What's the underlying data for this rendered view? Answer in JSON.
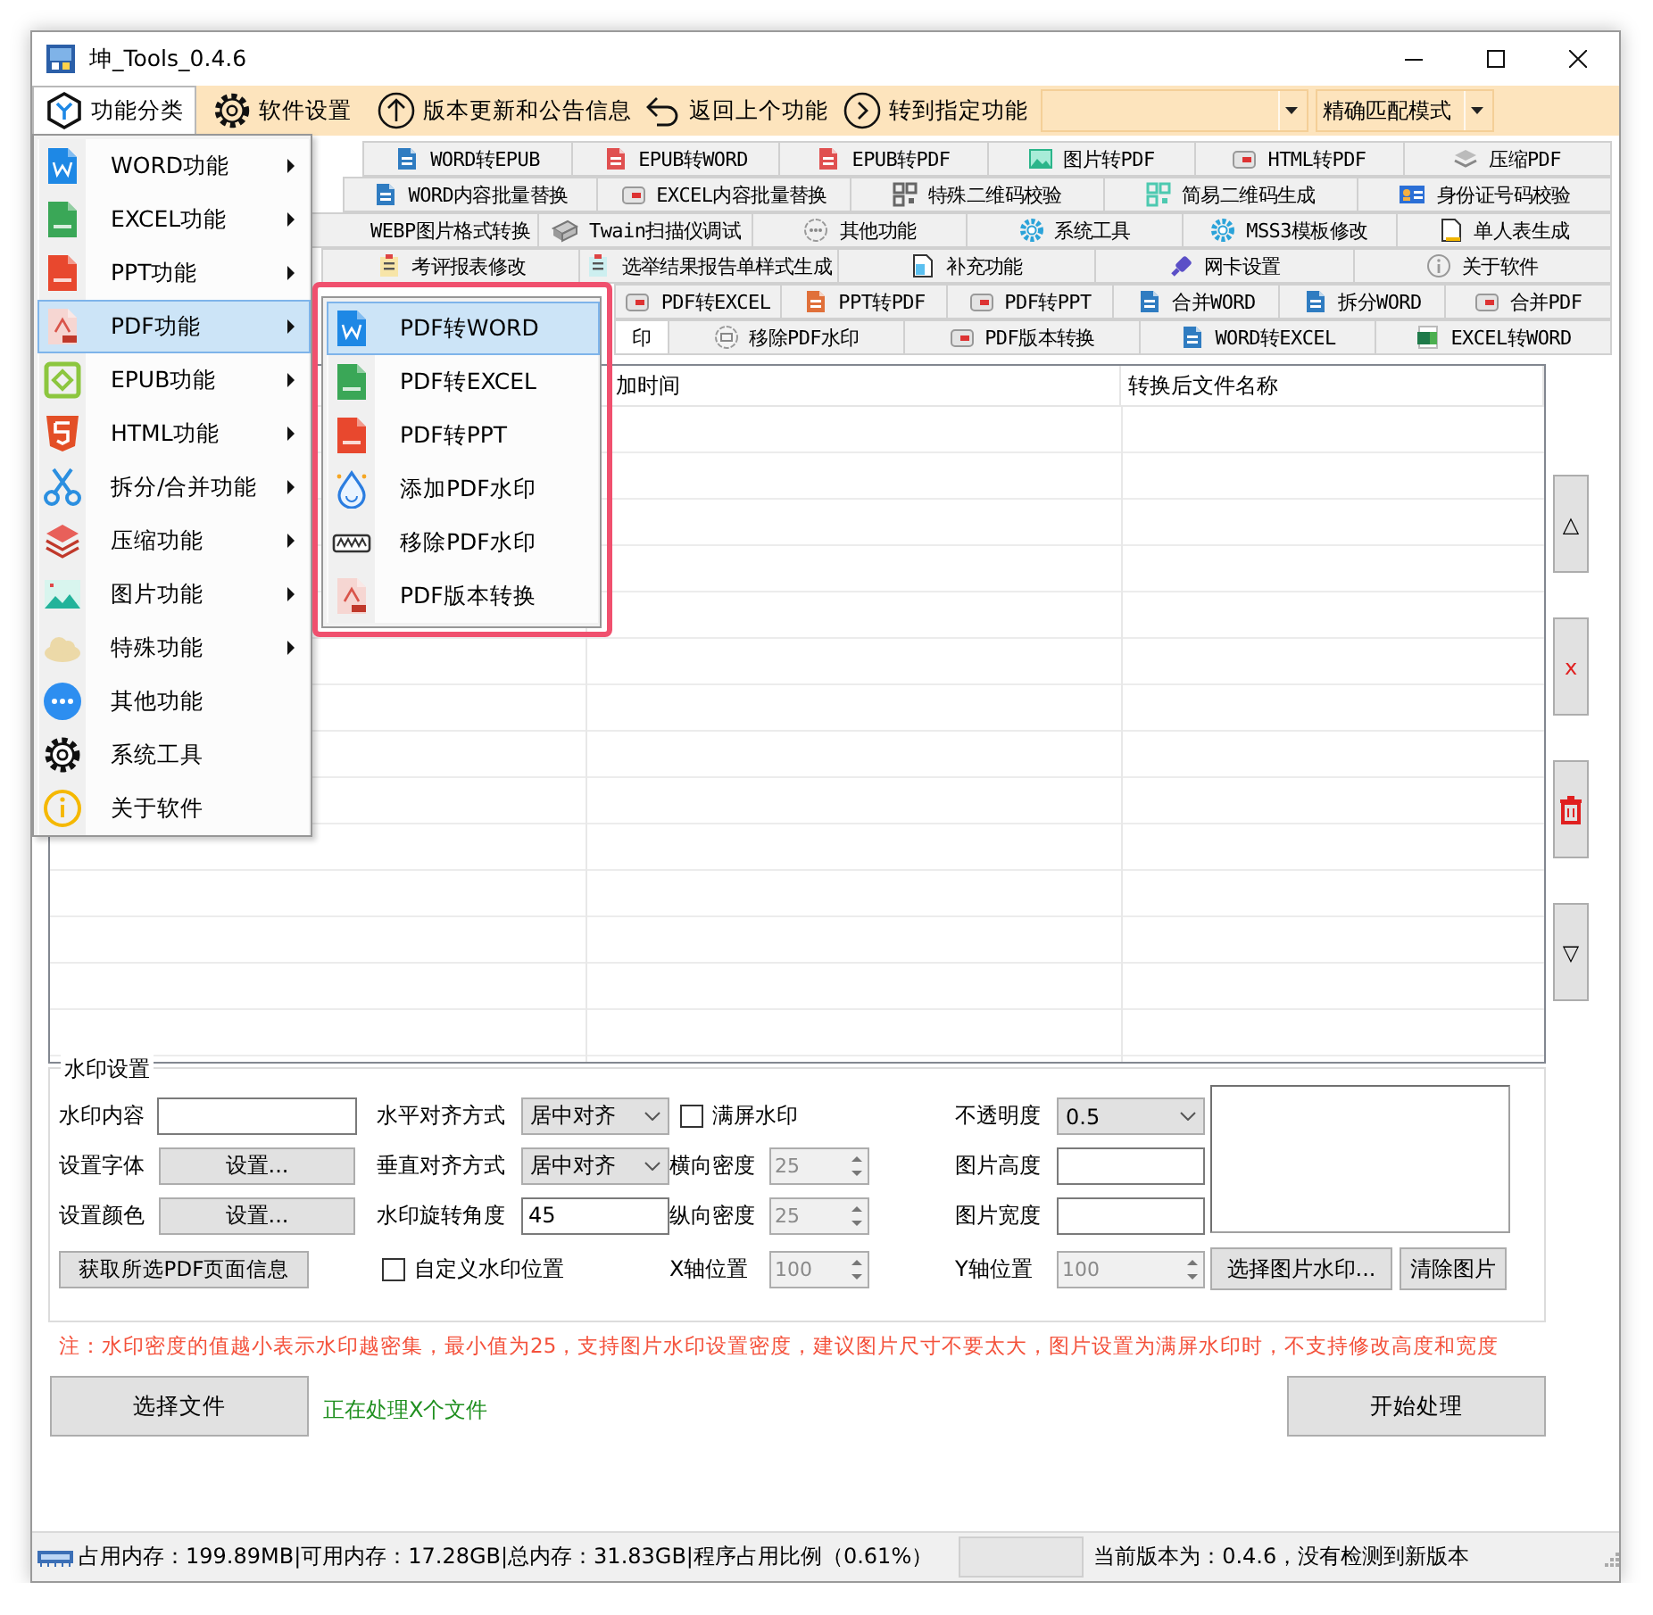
{
  "window": {
    "title": "坤_Tools_0.4.6"
  },
  "toolbar": {
    "items": [
      {
        "label": "功能分类",
        "selected": true
      },
      {
        "label": "软件设置",
        "selected": false
      },
      {
        "label": "版本更新和公告信息",
        "selected": false
      },
      {
        "label": "返回上个功能",
        "selected": false
      },
      {
        "label": "转到指定功能",
        "selected": false
      }
    ],
    "match_mode": "精确匹配模式"
  },
  "tab_rows": [
    [
      {
        "label": "WORD转EPUB",
        "selected": false
      },
      {
        "label": "EPUB转WORD",
        "selected": false
      },
      {
        "label": "EPUB转PDF",
        "selected": false
      },
      {
        "label": "图片转PDF",
        "selected": false
      },
      {
        "label": "HTML转PDF",
        "selected": false
      },
      {
        "label": "压缩PDF",
        "selected": false
      }
    ],
    [
      {
        "label": "WORD内容批量替换",
        "selected": false
      },
      {
        "label": "EXCEL内容批量替换",
        "selected": false
      },
      {
        "label": "特殊二维码校验",
        "selected": false
      },
      {
        "label": "简易二维码生成",
        "selected": false
      },
      {
        "label": "身份证号码校验",
        "selected": false
      }
    ],
    [
      {
        "label": "WEBP图片格式转换",
        "selected": false
      },
      {
        "label": "Twain扫描仪调试",
        "selected": false
      },
      {
        "label": "其他功能",
        "selected": false
      },
      {
        "label": "系统工具",
        "selected": false
      },
      {
        "label": "MSS3模板修改",
        "selected": false
      },
      {
        "label": "单人表生成",
        "selected": false
      }
    ],
    [
      {
        "label": "考评报表修改",
        "selected": false
      },
      {
        "label": "选举结果报告单样式生成",
        "selected": false
      },
      {
        "label": "补充功能",
        "selected": false
      },
      {
        "label": "网卡设置",
        "selected": false
      },
      {
        "label": "关于软件",
        "selected": false
      }
    ],
    [
      {
        "label": "PDF转EXCEL",
        "selected": false
      },
      {
        "label": "PPT转PDF",
        "selected": false
      },
      {
        "label": "PDF转PPT",
        "selected": false
      },
      {
        "label": "合并WORD",
        "selected": false
      },
      {
        "label": "拆分WORD",
        "selected": false
      },
      {
        "label": "合并PDF",
        "selected": false
      }
    ],
    [
      {
        "label": "印",
        "selected": true
      },
      {
        "label": "移除PDF水印",
        "selected": false
      },
      {
        "label": "PDF版本转换",
        "selected": false
      },
      {
        "label": "WORD转EXCEL",
        "selected": false
      },
      {
        "label": "EXCEL转WORD",
        "selected": false
      }
    ]
  ],
  "table": {
    "headers": [
      "加时间",
      "转换后文件名称"
    ]
  },
  "side_buttons": [
    {
      "kind": "glyph",
      "label": "△"
    },
    {
      "kind": "danger_glyph",
      "label": "x"
    },
    {
      "kind": "trash"
    },
    {
      "kind": "glyph",
      "label": "▽"
    }
  ],
  "watermark_settings": {
    "title": "水印设置",
    "content": {
      "label": "水印内容"
    },
    "font": {
      "label": "设置字体",
      "button": "设置..."
    },
    "color": {
      "label": "设置颜色",
      "button": "设置..."
    },
    "page_info_button": "获取所选PDF页面信息",
    "h_align": {
      "label": "水平对齐方式",
      "value": "居中对齐"
    },
    "v_align": {
      "label": "垂直对齐方式",
      "value": "居中对齐"
    },
    "rotation": {
      "label": "水印旋转角度",
      "value": "45"
    },
    "custom_position": {
      "label": "自定义水印位置",
      "checked": false
    },
    "fullscreen": {
      "label": "满屏水印",
      "checked": false
    },
    "h_density": {
      "label": "横向密度",
      "value": "25",
      "disabled": true
    },
    "v_density": {
      "label": "纵向密度",
      "value": "25",
      "disabled": true
    },
    "x_pos": {
      "label": "X轴位置",
      "value": "100",
      "disabled": true
    },
    "opacity": {
      "label": "不透明度",
      "value": "0.5"
    },
    "image_height": {
      "label": "图片高度"
    },
    "image_width": {
      "label": "图片宽度"
    },
    "y_pos": {
      "label": "Y轴位置",
      "value": "100",
      "disabled": true
    },
    "choose_image_button": "选择图片水印...",
    "clear_image_button": "清除图片"
  },
  "note": "注：水印密度的值越小表示水印越密集，最小值为25，支持图片水印设置密度，建议图片尺寸不要太大，图片设置为满屏水印时，不支持修改高度和宽度",
  "choose_file_button": "选择文件",
  "progress_text": "正在处理X个文件",
  "start_button": "开始处理",
  "status_bar": {
    "memory": "占用内存：199.89MB|可用内存：17.28GB|总内存：31.83GB|程序占用比例（0.61%）",
    "version": "当前版本为：0.4.6，没有检测到新版本"
  },
  "menu": {
    "items": [
      {
        "label": "WORD功能",
        "has_submenu": true,
        "selected": false
      },
      {
        "label": "EXCEL功能",
        "has_submenu": true,
        "selected": false
      },
      {
        "label": "PPT功能",
        "has_submenu": true,
        "selected": false
      },
      {
        "label": "PDF功能",
        "has_submenu": true,
        "selected": true
      },
      {
        "label": "EPUB功能",
        "has_submenu": true,
        "selected": false
      },
      {
        "label": "HTML功能",
        "has_submenu": true,
        "selected": false
      },
      {
        "label": "拆分/合并功能",
        "has_submenu": true,
        "selected": false
      },
      {
        "label": "压缩功能",
        "has_submenu": true,
        "selected": false
      },
      {
        "label": "图片功能",
        "has_submenu": true,
        "selected": false
      },
      {
        "label": "特殊功能",
        "has_submenu": true,
        "selected": false
      },
      {
        "label": "其他功能",
        "has_submenu": false,
        "selected": false
      },
      {
        "label": "系统工具",
        "has_submenu": false,
        "selected": false
      },
      {
        "label": "关于软件",
        "has_submenu": false,
        "selected": false
      }
    ]
  },
  "submenu": {
    "items": [
      {
        "label": "PDF转WORD",
        "selected": true
      },
      {
        "label": "PDF转EXCEL",
        "selected": false
      },
      {
        "label": "PDF转PPT",
        "selected": false
      },
      {
        "label": "添加PDF水印",
        "selected": false
      },
      {
        "label": "移除PDF水印",
        "selected": false
      },
      {
        "label": "PDF版本转换",
        "selected": false
      }
    ]
  }
}
